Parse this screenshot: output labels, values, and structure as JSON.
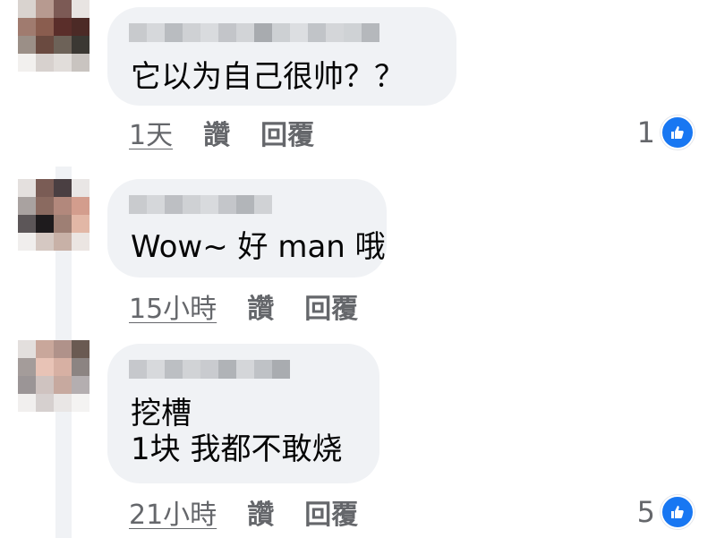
{
  "comments": [
    {
      "text_lines": [
        "它以为自己很帅？？"
      ],
      "time": "1天",
      "like_label": "讚",
      "reply_label": "回覆",
      "reaction_count": "1",
      "reaction_icon": "thumbs-up-icon"
    },
    {
      "text_lines": [
        "Wow~ 好 man 哦"
      ],
      "time": "15小時",
      "like_label": "讚",
      "reply_label": "回覆",
      "reaction_count": "",
      "reaction_icon": ""
    },
    {
      "text_lines": [
        "挖槽",
        "1块 我都不敢烧"
      ],
      "time": "21小時",
      "like_label": "讚",
      "reply_label": "回覆",
      "reaction_count": "5",
      "reaction_icon": "thumbs-up-icon"
    }
  ],
  "colors": {
    "bubble": "#f0f2f5",
    "meta_text": "#65676b",
    "like_blue": "#1877f2"
  }
}
